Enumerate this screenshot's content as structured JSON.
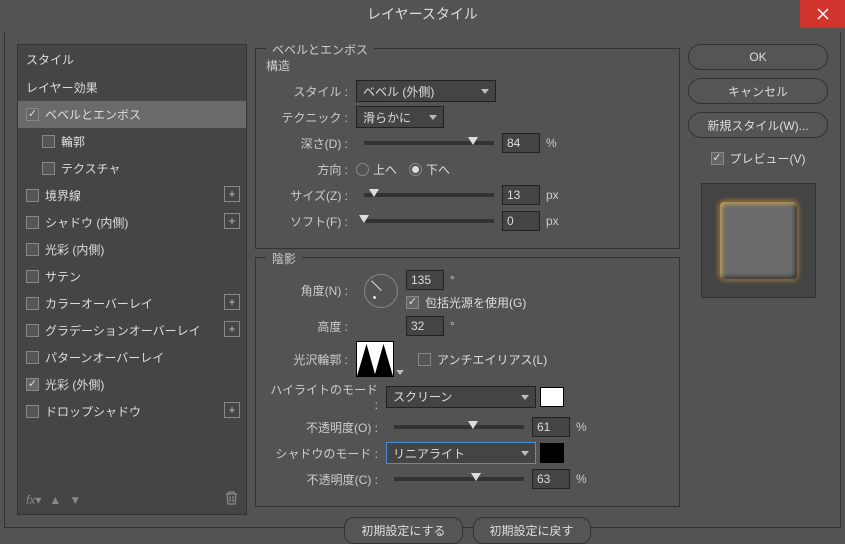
{
  "title": "レイヤースタイル",
  "side": {
    "header": "スタイル",
    "items": [
      {
        "label": "レイヤー効果",
        "ck": null
      },
      {
        "label": "ベベルとエンボス",
        "ck": true,
        "sel": true
      },
      {
        "label": "輪郭",
        "ck": false,
        "indent": true
      },
      {
        "label": "テクスチャ",
        "ck": false,
        "indent": true
      },
      {
        "label": "境界線",
        "ck": false,
        "add": true
      },
      {
        "label": "シャドウ (内側)",
        "ck": false,
        "add": true
      },
      {
        "label": "光彩 (内側)",
        "ck": false
      },
      {
        "label": "サテン",
        "ck": false
      },
      {
        "label": "カラーオーバーレイ",
        "ck": false,
        "add": true
      },
      {
        "label": "グラデーションオーバーレイ",
        "ck": false,
        "add": true
      },
      {
        "label": "パターンオーバーレイ",
        "ck": false
      },
      {
        "label": "光彩 (外側)",
        "ck": true
      },
      {
        "label": "ドロップシャドウ",
        "ck": false,
        "add": true
      }
    ],
    "fx": "fx"
  },
  "g1": {
    "title": "ベベルとエンボス",
    "sub": "構造",
    "style_lbl": "スタイル :",
    "style_val": "ベベル (外側)",
    "tech_lbl": "テクニック :",
    "tech_val": "滑らかに",
    "depth_lbl": "深さ(D) :",
    "depth_val": "84",
    "depth_pct": 84,
    "pct": "%",
    "dir_lbl": "方向 :",
    "up": "上へ",
    "down": "下へ",
    "size_lbl": "サイズ(Z) :",
    "size_val": "13",
    "size_pct": 8,
    "px": "px",
    "soft_lbl": "ソフト(F) :",
    "soft_val": "0",
    "soft_pct": 0
  },
  "g2": {
    "title": "陰影",
    "angle_lbl": "角度(N) :",
    "angle_val": "135",
    "deg": "°",
    "global_lbl": "包括光源を使用(G)",
    "alt_lbl": "高度 :",
    "alt_val": "32",
    "gloss_lbl": "光沢輪郭 :",
    "aa_lbl": "アンチエイリアス(L)",
    "hi_lbl": "ハイライトのモード :",
    "hi_val": "スクリーン",
    "hi_color": "#ffffff",
    "op_lbl": "不透明度(O) :",
    "op_val": "61",
    "op_pct": 61,
    "sh_lbl": "シャドウのモード :",
    "sh_val": "リニアライト",
    "sh_color": "#000000",
    "op2_lbl": "不透明度(C) :",
    "op2_val": "63",
    "op2_pct": 63
  },
  "btns": {
    "def": "初期設定にする",
    "reset": "初期設定に戻す"
  },
  "right": {
    "ok": "OK",
    "cancel": "キャンセル",
    "new": "新規スタイル(W)...",
    "preview": "プレビュー(V)"
  }
}
